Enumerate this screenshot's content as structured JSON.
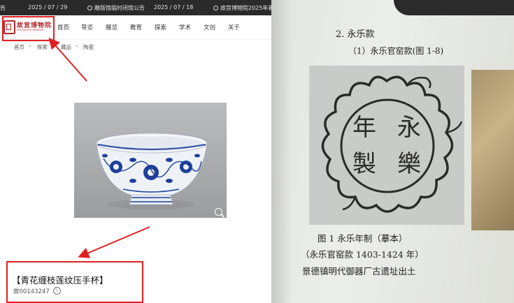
{
  "left_screenshot": {
    "topbar": {
      "items": [
        {
          "label": "告"
        },
        {
          "date": "2025 / 07 / 29"
        },
        {
          "label": "雕版馆临时闭馆公告"
        },
        {
          "date": "2025 / 07 / 18"
        },
        {
          "label": "故宫博物院2025年暑"
        }
      ]
    },
    "logo": {
      "text": "故宫博物院",
      "subtext": "THE PALACE MUSEUM"
    },
    "nav": [
      "首页",
      "导览",
      "展览",
      "教育",
      "探索",
      "学术",
      "文创",
      "关于"
    ],
    "breadcrumb": [
      "首页",
      "探索",
      "藏品",
      "陶瓷"
    ],
    "breadcrumb_sep": "»",
    "artifact": {
      "title": "【青花缠枝莲纹压手杯】",
      "object_id": "故00143247",
      "info_symbol": "i"
    }
  },
  "right_photo": {
    "heading": "2. 永乐款",
    "subheading": "（1）永乐官窑款(图 1-8)",
    "seal_characters": [
      "永",
      "樂",
      "年",
      "製"
    ],
    "caption_line1": "图 1  永乐年制（摹本）",
    "caption_line2": "（永乐官窑款   1403-1424 年）",
    "caption_line3": "景德镇明代御器厂古遗址出土"
  },
  "colors": {
    "brand_red": "#b3262a",
    "highlight_red": "#e02020",
    "topbar_bg": "#2a2a2a",
    "porcelain_blue": "#1f3f9a"
  }
}
